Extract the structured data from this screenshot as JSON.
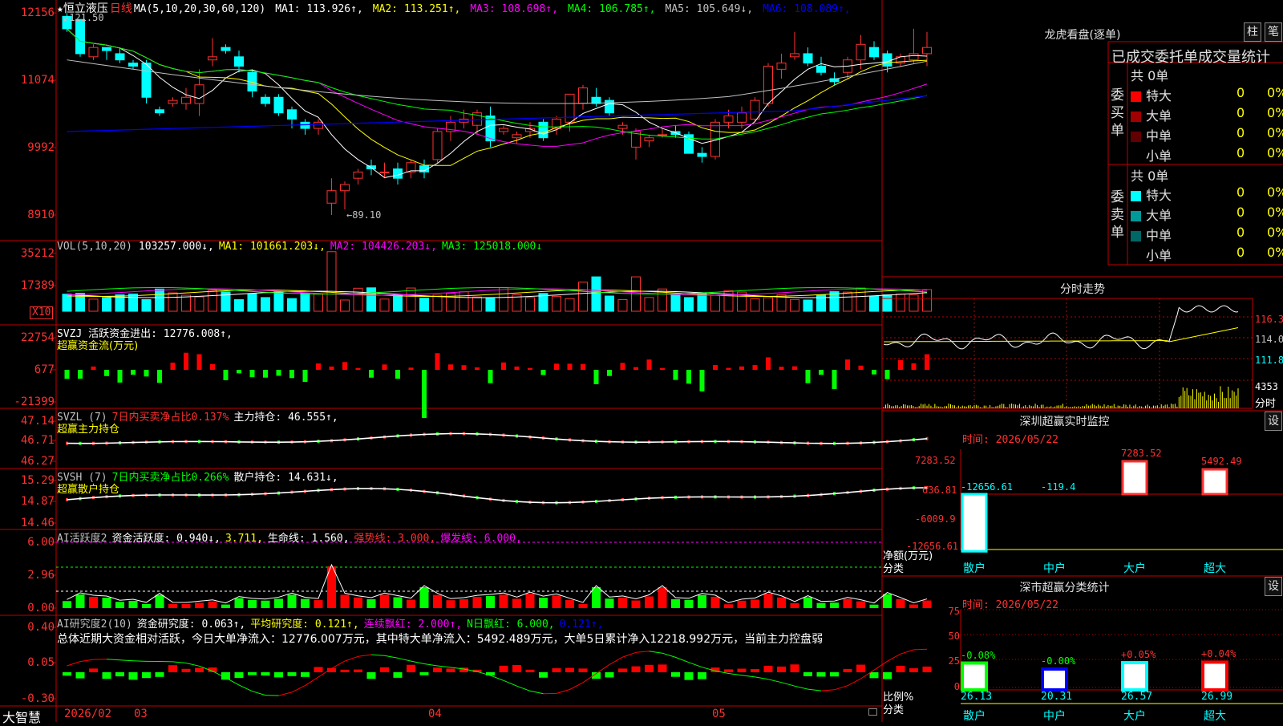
{
  "main_chart": {
    "star": "★",
    "name": "恒立液压",
    "period": "日线",
    "ma_label": "MA(5,10,20,30,60,120)",
    "ma_values": [
      {
        "label": "MA1: 113.926",
        "arrow": "↑",
        "color": "#ffffff"
      },
      {
        "label": "MA2: 113.251",
        "arrow": "↑",
        "color": "#ffff00"
      },
      {
        "label": "MA3: 108.698",
        "arrow": "↑",
        "color": "#ff00ff"
      },
      {
        "label": "MA4: 106.785",
        "arrow": "↑",
        "color": "#00ff00"
      },
      {
        "label": "MA5: 105.649",
        "arrow": "↓",
        "color": "#c0c0c0"
      },
      {
        "label": "MA6: 108.089",
        "arrow": "↑",
        "color": "#0000ff"
      }
    ],
    "y_ticks": [
      "12156",
      "11074",
      "9992",
      "8910"
    ],
    "high_marker": "121.50",
    "low_marker": "←89.10"
  },
  "vol_panel": {
    "title": "VOL(5,10,20)",
    "value": "103257.000↓,",
    "ma1": "MA1: 101661.203↓,",
    "ma2": "MA2: 104426.203↓,",
    "ma3": "MA3: 125018.000↓",
    "y_ticks": [
      "35212",
      "17389"
    ],
    "unit": "X10"
  },
  "svzj_panel": {
    "title": "SVZJ  活跃资金进出: 12776.008↑,",
    "subtitle": "超赢资金流(万元)",
    "y_ticks": [
      "22754",
      "677",
      "-21399"
    ]
  },
  "svzl_panel": {
    "title": "SVZL (7)",
    "ratio": "7日内买卖净占比0.137%",
    "hold": "主力持仓: 46.555↑,",
    "subtitle": "超赢主力持仓",
    "y_ticks": [
      "47.14",
      "46.71",
      "46.27"
    ]
  },
  "svsh_panel": {
    "title": "SVSH (7)",
    "ratio": "7日内买卖净占比0.266%",
    "hold": "散户持仓: 14.631↓,",
    "subtitle": "超赢散户持仓",
    "y_ticks": [
      "15.29",
      "14.87",
      "14.46"
    ]
  },
  "ai_active_panel": {
    "title": "AI活跃度2",
    "v1": "资金活跃度: 0.940↓,",
    "v2": "3.711,",
    "v3": "生命线: 1.560,",
    "v4": "强势线: 3.000,",
    "v5": "爆发线: 6.000,",
    "y_ticks": [
      "6.00",
      "2.96",
      "0.00"
    ]
  },
  "ai_research_panel": {
    "title": "AI研究度2(10)",
    "v1": "资金研究度: 0.063↑,",
    "v2": "平均研究度: 0.121↑,",
    "v3": "连续飘红: 2.000↑,",
    "v4": "N日飘红: 6.000,",
    "v5": "0.121↑,",
    "summary": "总体近期大资金相对活跃，今日大单净流入：12776.007万元，其中特大单净流入：5492.489万元，大单5日累计净入12218.992万元，当前主力控盘弱",
    "y_ticks": [
      "0.40",
      "0.05",
      "-0.30"
    ]
  },
  "bottom_axis": {
    "app_name": "大智慧",
    "labels": [
      "2026/02",
      "03",
      "04",
      "05"
    ]
  },
  "lhb": {
    "title": "龙虎看盘(逐单)",
    "btn_bar": "柱",
    "btn_pen": "笔",
    "header": "已成交委托单成交量统计",
    "buy_label": "委买单",
    "sell_label": "委卖单",
    "buy_total": "共 0单",
    "sell_total": "共 0单",
    "buy_rows": [
      {
        "name": "特大",
        "count": "0",
        "pct": "0%",
        "color": "#ff0000"
      },
      {
        "name": "大单",
        "count": "0",
        "pct": "0%",
        "color": "#a00000"
      },
      {
        "name": "中单",
        "count": "0",
        "pct": "0%",
        "color": "#600000"
      },
      {
        "name": "小单",
        "count": "0",
        "pct": "0%",
        "color": "#000000"
      }
    ],
    "sell_rows": [
      {
        "name": "特大",
        "count": "0",
        "pct": "0%",
        "color": "#00ffff"
      },
      {
        "name": "大单",
        "count": "0",
        "pct": "0%",
        "color": "#009999"
      },
      {
        "name": "中单",
        "count": "0",
        "pct": "0%",
        "color": "#006666"
      },
      {
        "name": "小单",
        "count": "0",
        "pct": "0%",
        "color": "#000000"
      }
    ]
  },
  "intraday": {
    "title": "分时走势",
    "y_ticks": [
      "116.3",
      "114.0",
      "111.8"
    ],
    "vol_tick": "4353",
    "unit": "分时"
  },
  "sz_monitor": {
    "title": "深圳超赢实时监控",
    "btn": "设",
    "time": "时间: 2026/05/22",
    "y_ticks": [
      "7283.52",
      "636.81",
      "-6009.9",
      "-12656.61"
    ],
    "y_unit": "净额(万元)",
    "x_unit": "分类",
    "values": [
      {
        "cat": "散户",
        "value": "-12656.61",
        "color": "#00ffff"
      },
      {
        "cat": "中户",
        "value": "-119.4",
        "color": "#00ffff"
      },
      {
        "cat": "大户",
        "value": "7283.52",
        "color": "#ff3030"
      },
      {
        "cat": "超大",
        "value": "5492.49",
        "color": "#ff3030"
      }
    ]
  },
  "sz_class": {
    "title": "深市超赢分类统计",
    "btn": "设",
    "time": "时间: 2026/05/22",
    "y_ticks": [
      "75",
      "50",
      "25",
      "0"
    ],
    "y_unit": "比例%",
    "x_unit": "分类",
    "items": [
      {
        "cat": "散户",
        "change": "-0.08%",
        "value": "26.13",
        "chg_color": "#00ff00"
      },
      {
        "cat": "中户",
        "change": "-0.00%",
        "value": "20.31",
        "chg_color": "#00ff00"
      },
      {
        "cat": "大户",
        "change": "+0.05%",
        "value": "26.57",
        "chg_color": "#ff3030"
      },
      {
        "cat": "超大",
        "change": "+0.04%",
        "value": "26.99",
        "chg_color": "#ff3030"
      }
    ]
  },
  "chart_data": {
    "type": "candlestick",
    "candles": [
      [
        121.0,
        121.5,
        118.5,
        119.0
      ],
      [
        120.5,
        120.5,
        114.5,
        115.0
      ],
      [
        114.5,
        116.5,
        114.0,
        116.0
      ],
      [
        116.0,
        116.0,
        114.0,
        115.5
      ],
      [
        115.0,
        116.0,
        113.5,
        114.0
      ],
      [
        113.5,
        114.0,
        112.5,
        113.0
      ],
      [
        113.5,
        114.0,
        107.0,
        108.0
      ],
      [
        106.0,
        106.5,
        105.0,
        105.5
      ],
      [
        107.0,
        108.0,
        106.5,
        107.5
      ],
      [
        107.0,
        109.5,
        106.0,
        108.0
      ],
      [
        107.0,
        112.5,
        105.0,
        110.0
      ],
      [
        114.0,
        117.5,
        113.0,
        114.5
      ],
      [
        116.0,
        116.5,
        115.0,
        115.5
      ],
      [
        114.5,
        115.5,
        112.0,
        113.0
      ],
      [
        112.0,
        112.5,
        108.0,
        109.0
      ],
      [
        108.0,
        108.5,
        106.5,
        107.0
      ],
      [
        108.0,
        108.5,
        105.0,
        105.5
      ],
      [
        106.0,
        106.5,
        103.0,
        104.5
      ],
      [
        104.0,
        104.5,
        102.0,
        103.0
      ],
      [
        103.0,
        104.5,
        102.0,
        104.0
      ],
      [
        91.0,
        95.0,
        89.1,
        93.0
      ],
      [
        93.0,
        94.5,
        90.0,
        94.0
      ],
      [
        95.0,
        96.5,
        94.0,
        96.0
      ],
      [
        97.0,
        98.0,
        95.5,
        96.5
      ],
      [
        96.0,
        97.5,
        95.0,
        96.0
      ],
      [
        96.5,
        97.5,
        94.0,
        95.0
      ],
      [
        96.0,
        98.0,
        95.0,
        97.5
      ],
      [
        97.0,
        98.0,
        95.0,
        96.0
      ],
      [
        98.0,
        103.0,
        97.5,
        102.5
      ],
      [
        102.5,
        105.0,
        101.0,
        104.0
      ],
      [
        104.0,
        106.0,
        103.0,
        104.5
      ],
      [
        103.5,
        106.0,
        102.0,
        105.5
      ],
      [
        105.0,
        106.5,
        100.0,
        101.0
      ],
      [
        102.5,
        103.5,
        102.0,
        103.0
      ],
      [
        101.5,
        102.5,
        100.5,
        102.0
      ],
      [
        102.5,
        104.0,
        101.5,
        103.0
      ],
      [
        104.0,
        104.5,
        101.0,
        101.5
      ],
      [
        103.0,
        105.0,
        102.0,
        104.5
      ],
      [
        104.0,
        108.5,
        102.5,
        108.5
      ],
      [
        107.0,
        110.0,
        106.0,
        109.5
      ],
      [
        108.0,
        109.5,
        106.5,
        107.0
      ],
      [
        107.5,
        108.0,
        105.0,
        105.5
      ],
      [
        103.0,
        104.0,
        102.0,
        103.5
      ],
      [
        100.0,
        103.0,
        98.0,
        102.5
      ],
      [
        101.0,
        102.0,
        100.0,
        101.5
      ],
      [
        102.0,
        103.0,
        101.5,
        102.0
      ],
      [
        102.5,
        103.5,
        101.5,
        102.0
      ],
      [
        102.0,
        102.5,
        99.0,
        99.0
      ],
      [
        99.0,
        100.0,
        97.5,
        98.5
      ],
      [
        98.5,
        104.5,
        98.0,
        104.0
      ],
      [
        104.0,
        106.0,
        103.0,
        105.0
      ],
      [
        104.0,
        106.5,
        103.0,
        105.5
      ],
      [
        104.5,
        108.0,
        104.0,
        107.5
      ],
      [
        107.0,
        113.5,
        106.5,
        113.0
      ],
      [
        112.5,
        115.0,
        111.0,
        113.5
      ],
      [
        114.5,
        118.5,
        114.0,
        115.0
      ],
      [
        115.0,
        116.0,
        113.0,
        113.5
      ],
      [
        113.0,
        114.5,
        111.5,
        112.0
      ],
      [
        111.0,
        112.0,
        110.0,
        110.5
      ],
      [
        112.0,
        114.5,
        111.0,
        114.0
      ],
      [
        114.0,
        118.0,
        112.5,
        116.5
      ],
      [
        116.0,
        117.0,
        114.0,
        114.5
      ],
      [
        115.0,
        115.5,
        112.0,
        113.0
      ],
      [
        113.5,
        115.0,
        113.0,
        114.5
      ],
      [
        114.0,
        119.0,
        113.5,
        115.0
      ],
      [
        115.0,
        118.5,
        113.0,
        116.0
      ]
    ]
  }
}
